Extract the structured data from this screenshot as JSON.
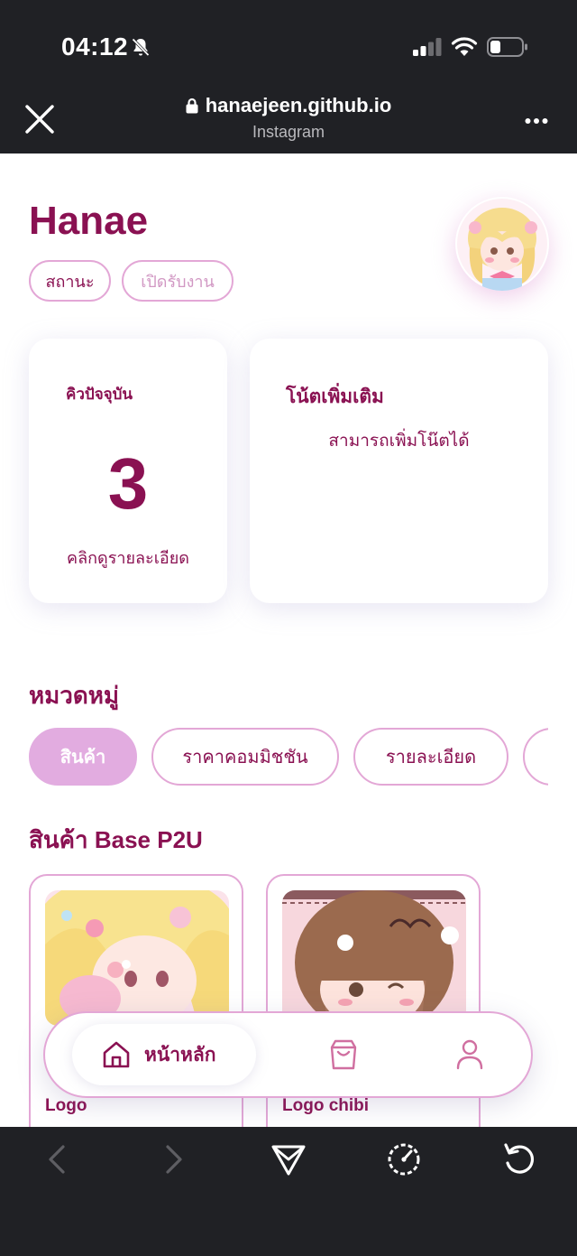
{
  "status_bar": {
    "time": "04:12"
  },
  "browser": {
    "domain": "hanaejeen.github.io",
    "source": "Instagram"
  },
  "profile": {
    "name": "Hanae",
    "chips": [
      "สถานะ",
      "เปิดรับงาน"
    ]
  },
  "queue_card": {
    "label": "คิวปัจจุบัน",
    "number": "3",
    "link": "คลิกดูรายละเอียด"
  },
  "note_card": {
    "title": "โน้ตเพิ่มเติม",
    "text": "สามารถเพิ่มโน๊ตได้"
  },
  "categories": {
    "title": "หมวดหมู่",
    "tabs": [
      "สินค้า",
      "ราคาคอมมิชชัน",
      "รายละเอียด",
      ""
    ]
  },
  "products": {
    "title": "สินค้า Base P2U",
    "items": [
      {
        "name": "Logo"
      },
      {
        "name": "Logo chibi"
      }
    ]
  },
  "bottom_nav": {
    "home_label": "หน้าหลัก"
  },
  "colors": {
    "accent": "#8a1152",
    "chip_border": "#e3a7d6",
    "tab_active": "#e2ace0",
    "chrome": "#202125"
  }
}
